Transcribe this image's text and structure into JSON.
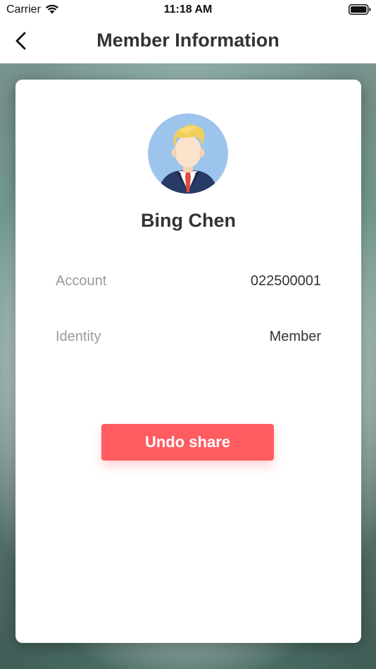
{
  "status_bar": {
    "carrier": "Carrier",
    "time": "11:18 AM",
    "wifi_icon": "wifi-icon",
    "battery_icon": "battery-icon"
  },
  "nav": {
    "back_icon": "chevron-left-icon",
    "title": "Member Information"
  },
  "member": {
    "avatar_icon": "avatar-man-in-suit",
    "name": "Bing Chen",
    "rows": [
      {
        "label": "Account",
        "value": "022500001"
      },
      {
        "label": "Identity",
        "value": "Member"
      }
    ]
  },
  "actions": {
    "undo_share_label": "Undo share"
  },
  "colors": {
    "accent": "#ff5c62",
    "title_text": "#333333",
    "label_text": "#9a9a9a",
    "avatar_bg": "#9cc4ec"
  }
}
